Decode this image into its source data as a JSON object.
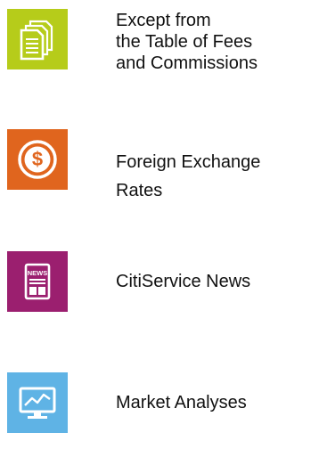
{
  "colors": {
    "fees_tile": "#b6cc1a",
    "fx_tile": "#e0651e",
    "news_tile": "#9b1f6f",
    "market_tile": "#5fb3e5",
    "icon": "#ffffff",
    "text": "#111111"
  },
  "items": [
    {
      "id": "fees",
      "icon": "documents-icon",
      "lines": [
        "Except from",
        "the Table of Fees",
        "and Commissions"
      ]
    },
    {
      "id": "fx",
      "icon": "dollar-coin-icon",
      "lines": [
        "Foreign Exchange",
        "Rates"
      ]
    },
    {
      "id": "news",
      "icon": "newspaper-icon",
      "lines": [
        "CitiService News"
      ]
    },
    {
      "id": "market",
      "icon": "monitor-chart-icon",
      "lines": [
        "Market Analyses"
      ]
    }
  ]
}
